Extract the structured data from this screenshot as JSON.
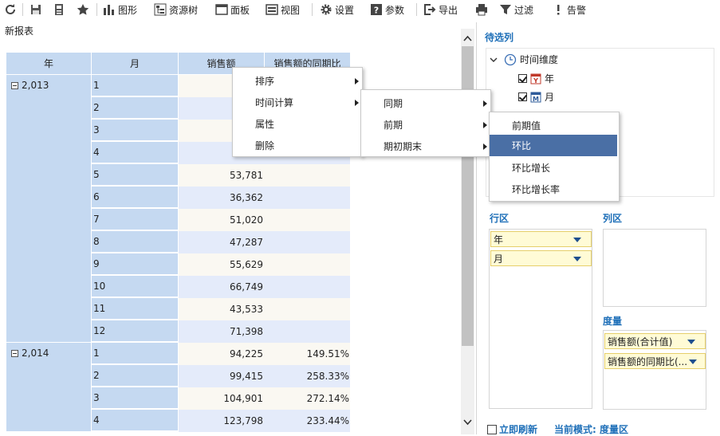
{
  "toolbar": {
    "items": [
      {
        "icon": "refresh-icon"
      },
      {
        "icon": "save-icon"
      },
      {
        "icon": "save-as-icon"
      },
      {
        "icon": "favorite-star-icon"
      },
      {
        "icon": "chart-icon",
        "label": "图形"
      },
      {
        "icon": "resource-tree-icon",
        "label": "资源树"
      },
      {
        "icon": "panel-icon",
        "label": "面板"
      },
      {
        "icon": "view-icon",
        "label": "视图"
      },
      {
        "icon": "gear-icon",
        "label": "设置"
      },
      {
        "icon": "param-icon",
        "label": "参数"
      },
      {
        "icon": "export-icon",
        "label": "导出"
      },
      {
        "icon": "print-icon",
        "label": ""
      },
      {
        "icon": "filter-icon",
        "label": "过滤"
      },
      {
        "icon": "alert-icon",
        "label": "告警"
      }
    ]
  },
  "report": {
    "title": "新报表"
  },
  "table": {
    "headers": [
      "年",
      "月",
      "销售额",
      "销售额的同期比"
    ],
    "groups": [
      {
        "year": "2,013",
        "rows": [
          {
            "month": "1",
            "sales": "",
            "ratio": ""
          },
          {
            "month": "2",
            "sales": "",
            "ratio": ""
          },
          {
            "month": "3",
            "sales": "",
            "ratio": ""
          },
          {
            "month": "4",
            "sales": "",
            "ratio": ""
          },
          {
            "month": "5",
            "sales": "53,781",
            "ratio": ""
          },
          {
            "month": "6",
            "sales": "36,362",
            "ratio": ""
          },
          {
            "month": "7",
            "sales": "51,020",
            "ratio": ""
          },
          {
            "month": "8",
            "sales": "47,287",
            "ratio": ""
          },
          {
            "month": "9",
            "sales": "55,629",
            "ratio": ""
          },
          {
            "month": "10",
            "sales": "66,749",
            "ratio": ""
          },
          {
            "month": "11",
            "sales": "43,533",
            "ratio": ""
          },
          {
            "month": "12",
            "sales": "71,398",
            "ratio": ""
          }
        ]
      },
      {
        "year": "2,014",
        "rows": [
          {
            "month": "1",
            "sales": "94,225",
            "ratio": "149.51%"
          },
          {
            "month": "2",
            "sales": "99,415",
            "ratio": "258.33%"
          },
          {
            "month": "3",
            "sales": "104,901",
            "ratio": "272.14%"
          },
          {
            "month": "4",
            "sales": "123,798",
            "ratio": "233.44%"
          }
        ]
      }
    ]
  },
  "context_menu": {
    "main": [
      "排序",
      "时间计算",
      "属性",
      "删除"
    ],
    "time_calc": [
      "同期",
      "前期",
      "期初期末"
    ],
    "prior": [
      "前期值",
      "环比",
      "环比增长",
      "环比增长率"
    ],
    "selected": "环比"
  },
  "panel": {
    "candidates_title": "待选列",
    "tree": {
      "root": "时间维度",
      "children": [
        "年",
        "月"
      ]
    },
    "row_area_title": "行区",
    "row_fields": [
      "年",
      "月"
    ],
    "col_area_title": "列区",
    "measure_title": "度量",
    "measure_fields": [
      "销售额(合计值)",
      "销售额的同期比(..."
    ],
    "refresh_label": "立即刷新",
    "mode_label": "当前模式: 度量区"
  }
}
